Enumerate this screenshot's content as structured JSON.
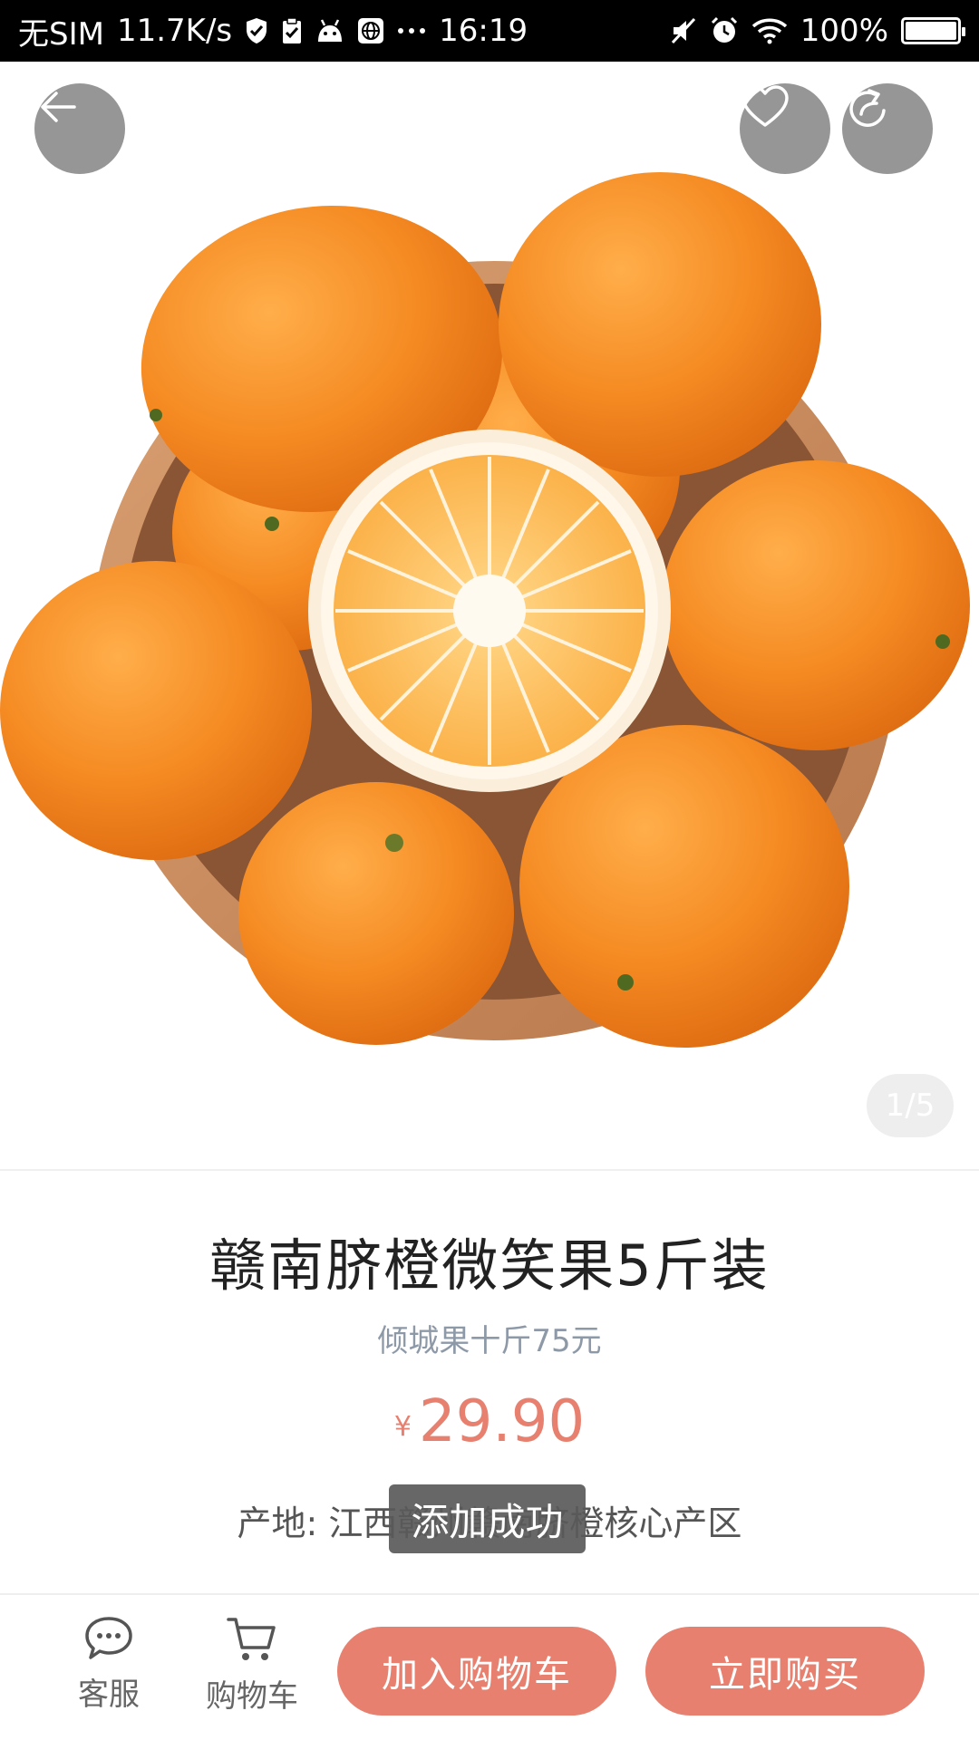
{
  "status_bar": {
    "carrier": "无SIM",
    "net_speed": "11.7K/s",
    "time": "16:19",
    "battery": "100%",
    "battery_level": 1.0,
    "icons": [
      "shield-check-icon",
      "clipboard-check-icon",
      "android-icon",
      "globe-icon",
      "more-dots-icon",
      "mute-icon",
      "alarm-icon",
      "wifi-icon",
      "battery-icon"
    ]
  },
  "header": {
    "back_icon": "arrow-left-icon",
    "favorite_icon": "heart-icon",
    "share_icon": "share-icon"
  },
  "gallery": {
    "pager": "1/5",
    "image": "oranges-in-wooden-bowl"
  },
  "product": {
    "title": "赣南脐橙微笑果5斤装",
    "subtitle": "倾城果十斤75元",
    "currency": "¥",
    "price": "29.90",
    "origin": "产地: 江西赣州赣南脐橙核心产区"
  },
  "toast": {
    "message": "添加成功"
  },
  "bottom_bar": {
    "service_label": "客服",
    "cart_label": "购物车",
    "add_to_cart_label": "加入购物车",
    "buy_now_label": "立即购买"
  },
  "colors": {
    "accent": "#e8806f",
    "subtitle": "#8e99a8",
    "orange": "#f18a1f"
  }
}
